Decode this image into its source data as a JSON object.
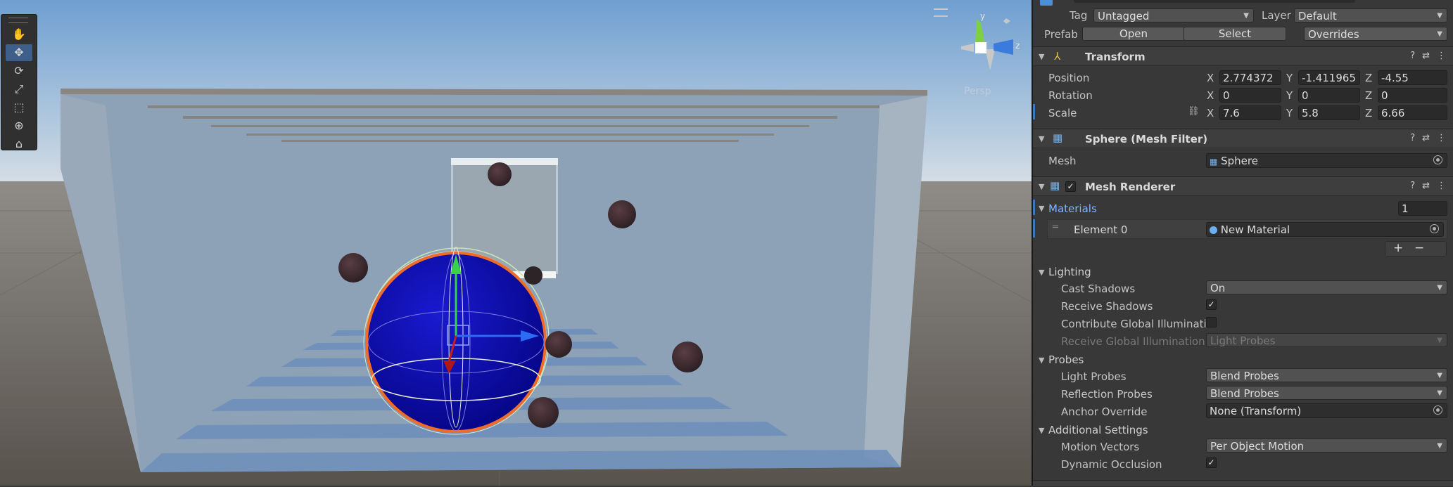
{
  "toolbar": {
    "tools": [
      "hand-tool",
      "move-tool",
      "rotate-tool",
      "scale-tool",
      "rect-tool",
      "transform-tool",
      "custom-tool"
    ]
  },
  "gizmo": {
    "axis_y": "y",
    "axis_z": "z",
    "view_label": "Persp"
  },
  "inspector": {
    "tag_label": "Tag",
    "tag_value": "Untagged",
    "layer_label": "Layer",
    "layer_value": "Default",
    "prefab_label": "Prefab",
    "prefab_open": "Open",
    "prefab_select": "Select",
    "prefab_overrides": "Overrides",
    "transform": {
      "title": "Transform",
      "position_label": "Position",
      "rotation_label": "Rotation",
      "scale_label": "Scale",
      "axis_x": "X",
      "axis_y": "Y",
      "axis_z": "Z",
      "position": {
        "x": "2.774372",
        "y": "-1.411965",
        "z": "-4.55"
      },
      "rotation": {
        "x": "0",
        "y": "0",
        "z": "0"
      },
      "scale": {
        "x": "7.6",
        "y": "5.8",
        "z": "6.66"
      }
    },
    "mesh_filter": {
      "title": "Sphere (Mesh Filter)",
      "mesh_label": "Mesh",
      "mesh_value": "Sphere"
    },
    "mesh_renderer": {
      "title": "Mesh Renderer",
      "materials_label": "Materials",
      "materials_count": "1",
      "element_label": "Element 0",
      "element_value": "New Material",
      "add": "+",
      "remove": "−",
      "lighting_label": "Lighting",
      "cast_shadows_label": "Cast Shadows",
      "cast_shadows_value": "On",
      "receive_shadows_label": "Receive Shadows",
      "contribute_gi_label": "Contribute Global Illuminatio",
      "receive_gi_label": "Receive Global Illumination",
      "receive_gi_value": "Light Probes",
      "probes_label": "Probes",
      "light_probes_label": "Light Probes",
      "light_probes_value": "Blend Probes",
      "reflection_probes_label": "Reflection Probes",
      "reflection_probes_value": "Blend Probes",
      "anchor_override_label": "Anchor Override",
      "anchor_override_value": "None (Transform)",
      "additional_label": "Additional Settings",
      "motion_vectors_label": "Motion Vectors",
      "motion_vectors_value": "Per Object Motion",
      "dynamic_occlusion_label": "Dynamic Occlusion"
    }
  }
}
